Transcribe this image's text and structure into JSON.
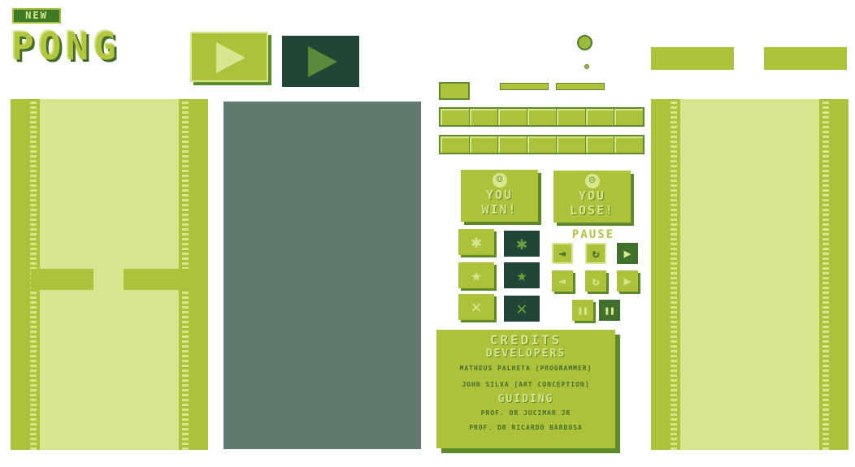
{
  "logo": {
    "badge": "NEW",
    "title": "PONG"
  },
  "messages": {
    "win": "YOU\nWIN!",
    "lose": "YOU\nLOSE!",
    "win_face": "☺",
    "lose_face": "☹"
  },
  "pause": {
    "label": "PAUSE"
  },
  "icons": {
    "settings": "✱",
    "star": "★",
    "close": "✕",
    "exit": "⇥",
    "restart": "↻",
    "play": "▶",
    "pause": "❚❚"
  },
  "credits": {
    "title": "CREDITS",
    "developers_heading": "DEVELOPERS",
    "developer_1": "MATHEUS PALHETA [PROGRAMMER]",
    "developer_2": "JOHN SILVA [ART CONCEPTION]",
    "guiding_heading": "GUIDING",
    "guide_1": "PROF. DR JUCIMAR JR",
    "guide_2": "PROF. DR RICARDO BARBOSA"
  },
  "colors": {
    "light": "#d6e58e",
    "mid": "#aec13b",
    "dark": "#5d8a2a",
    "darkest": "#214635",
    "gray": "#627a6e"
  }
}
